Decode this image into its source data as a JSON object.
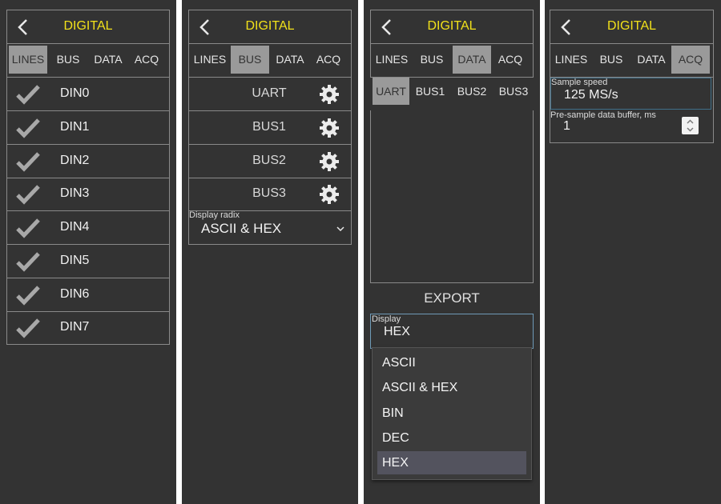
{
  "header": {
    "title": "DIGITAL"
  },
  "tabs": [
    "LINES",
    "BUS",
    "DATA",
    "ACQ"
  ],
  "lines": [
    "DIN0",
    "DIN1",
    "DIN2",
    "DIN3",
    "DIN4",
    "DIN5",
    "DIN6",
    "DIN7"
  ],
  "bus": {
    "items": [
      "UART",
      "BUS1",
      "BUS2",
      "BUS3"
    ],
    "radix_label": "Display radix",
    "radix_value": "ASCII & HEX"
  },
  "data": {
    "subtabs": [
      "UART",
      "BUS1",
      "BUS2",
      "BUS3"
    ],
    "export_label": "EXPORT",
    "display_label": "Display",
    "display_value": "HEX",
    "options": [
      "ASCII",
      "ASCII & HEX",
      "BIN",
      "DEC",
      "HEX"
    ]
  },
  "acq": {
    "sample_speed_label": "Sample speed",
    "sample_speed_value": "125 MS/s",
    "presample_label": "Pre-sample data buffer, ms",
    "presample_value": "1"
  },
  "colors": {
    "panel_bg": "#333333",
    "title": "#f2e11a",
    "active_tab": "#9a9a9a",
    "border": "#8a8a8a",
    "dropdown_selected": "#53535e"
  },
  "icons": [
    "back-chevron-icon",
    "check-icon",
    "gear-icon",
    "chevron-down-icon",
    "spinner-arrows-icon"
  ]
}
